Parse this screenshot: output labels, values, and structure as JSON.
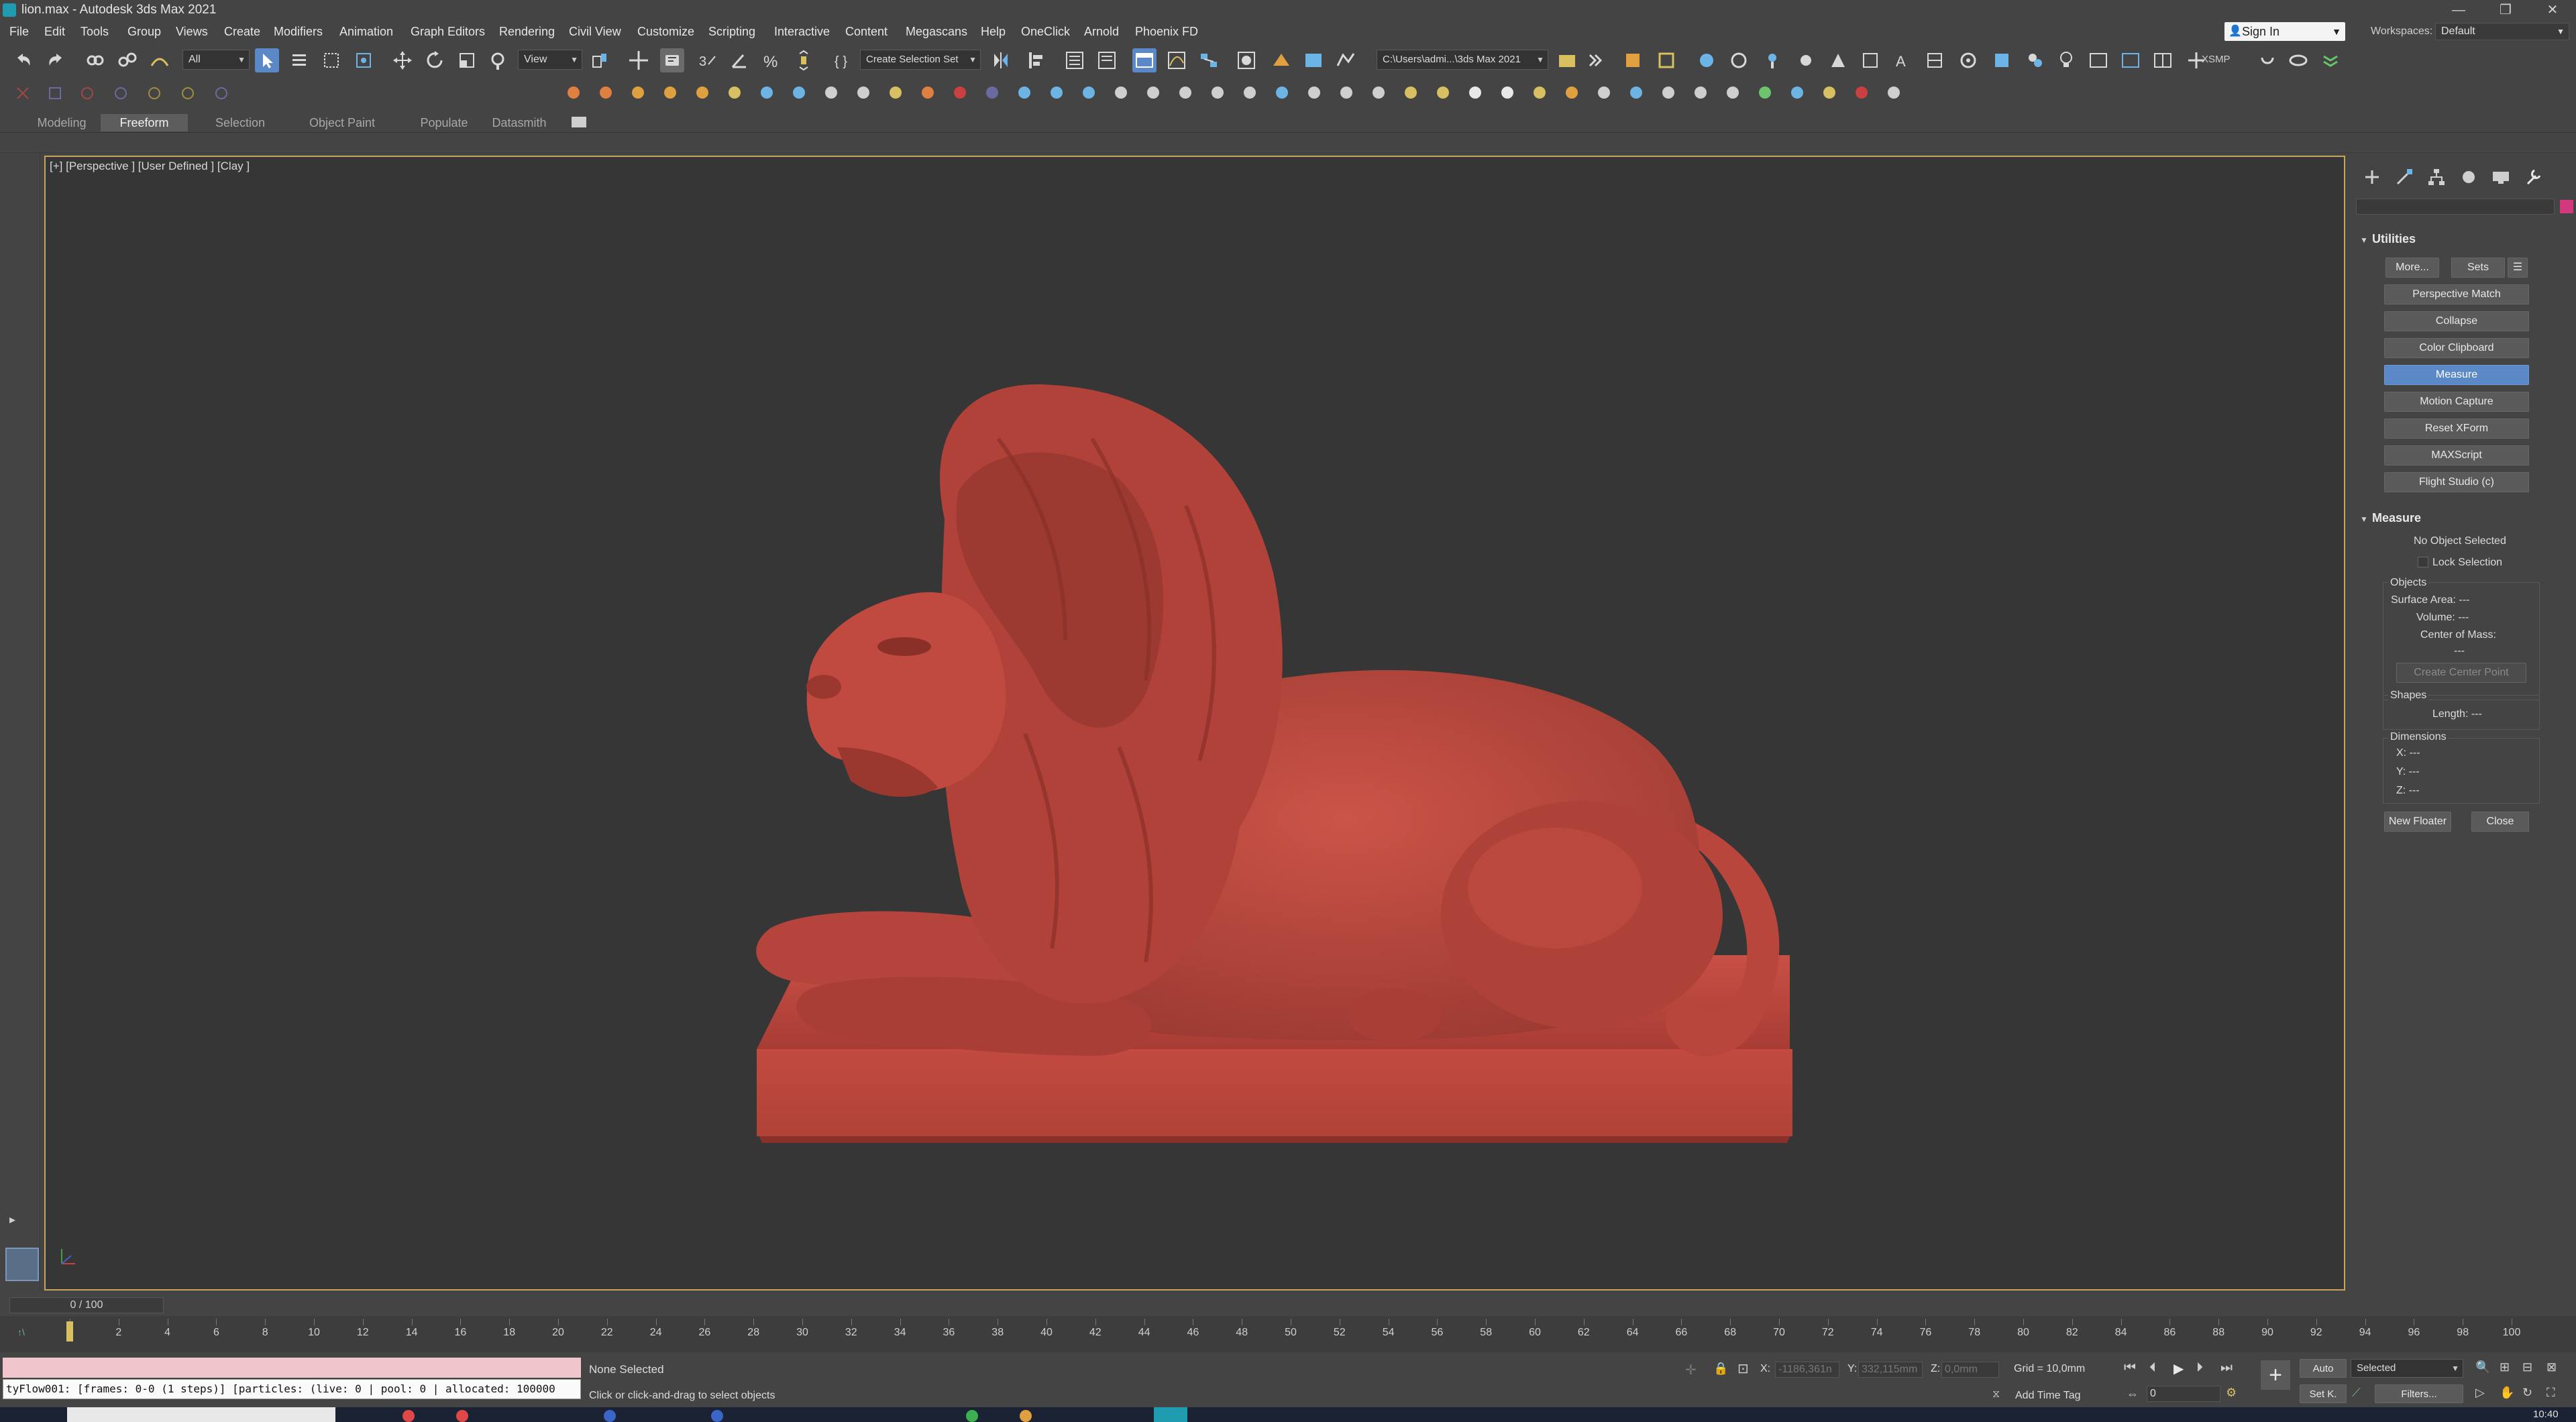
{
  "window": {
    "title": "lion.max - Autodesk 3ds Max 2021",
    "min_glyph": "—",
    "restore_glyph": "❐",
    "close_glyph": "✕"
  },
  "menu": [
    "File",
    "Edit",
    "Tools",
    "Group",
    "Views",
    "Create",
    "Modifiers",
    "Animation",
    "Graph Editors",
    "Rendering",
    "Civil View",
    "Customize",
    "Scripting",
    "Interactive",
    "Content",
    "Megascans",
    "Help",
    "OneClick",
    "Arnold",
    "Phoenix FD"
  ],
  "account": {
    "sign_in": "Sign In",
    "workspaces_label": "Workspaces:",
    "workspace": "Default"
  },
  "toolbar": {
    "filter": "All",
    "ref_coord": "View",
    "selection_set": "Create Selection Set",
    "project_path": "C:\\Users\\admi...\\3ds Max 2021",
    "xsmp": "XSMP"
  },
  "ribbon_tabs": [
    "Modeling",
    "Freeform",
    "Selection",
    "Object Paint",
    "Populate",
    "Datasmith"
  ],
  "ribbon_active": "Freeform",
  "viewport": {
    "label": "[+] [Perspective ] [User Defined ] [Clay ]"
  },
  "utilities": {
    "title": "Utilities",
    "more": "More...",
    "sets": "Sets",
    "buttons": [
      "Perspective Match",
      "Collapse",
      "Color Clipboard",
      "Measure",
      "Motion Capture",
      "Reset XForm",
      "MAXScript",
      "Flight Studio (c)"
    ],
    "active": "Measure"
  },
  "measure": {
    "title": "Measure",
    "no_object": "No Object Selected",
    "lock_selection": "Lock Selection",
    "objects_label": "Objects",
    "surface_area": "Surface Area: ---",
    "volume": "Volume: ---",
    "center_of_mass": "Center of Mass:",
    "com_value": "---",
    "create_center_point": "Create Center Point",
    "shapes_label": "Shapes",
    "length": "Length: ---",
    "dimensions_label": "Dimensions",
    "x": "X: ---",
    "y": "Y: ---",
    "z": "Z: ---",
    "new_floater": "New Floater",
    "close": "Close"
  },
  "timeline": {
    "slider": "0 / 100",
    "ticks": [
      0,
      2,
      4,
      6,
      8,
      10,
      12,
      14,
      16,
      18,
      20,
      22,
      24,
      26,
      28,
      30,
      32,
      34,
      36,
      38,
      40,
      42,
      44,
      46,
      48,
      50,
      52,
      54,
      56,
      58,
      60,
      62,
      64,
      66,
      68,
      70,
      72,
      74,
      76,
      78,
      80,
      82,
      84,
      86,
      88,
      90,
      92,
      94,
      96,
      98,
      100
    ],
    "current_frame": 0
  },
  "status": {
    "maxscript_output": "tyFlow001: [frames: 0-0 (1 steps)] [particles: (live: 0 | pool: 0 | allocated: 100000",
    "selection": "None Selected",
    "prompt": "Click or click-and-drag to select objects",
    "x_label": "X:",
    "x_value": "-1186,361n",
    "y_label": "Y:",
    "y_value": "332,115mm",
    "z_label": "Z:",
    "z_value": "0,0mm",
    "grid": "Grid = 10,0mm",
    "add_time_tag": "Add Time Tag",
    "auto": "Auto",
    "set_key": "Set K.",
    "key_filter": "Selected",
    "filters": "Filters...",
    "frame_field": "0",
    "clock": "10:40"
  },
  "colors": {
    "viewport_border": "#c8a45a",
    "active_button": "#5b88c7",
    "lion": "#b4443c",
    "maxscript_bg": "#f0c6cc"
  }
}
